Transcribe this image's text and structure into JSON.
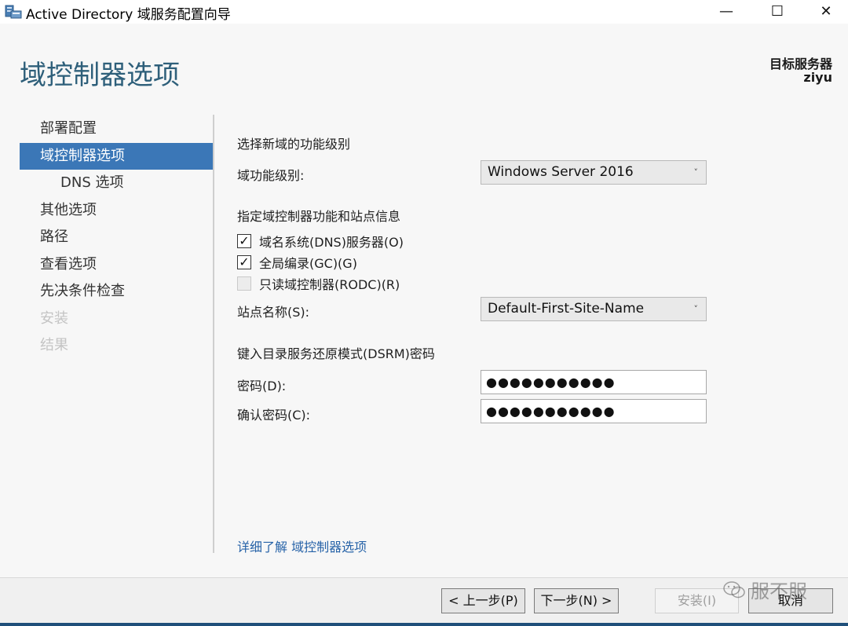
{
  "window": {
    "title": "Active Directory 域服务配置向导",
    "minimize_glyph": "—",
    "maximize_glyph": "☐",
    "close_glyph": "✕",
    "icon": "server-wizard-icon"
  },
  "header": {
    "page_title": "域控制器选项",
    "target_label": "目标服务器",
    "target_name": "ziyu"
  },
  "nav": {
    "items": [
      {
        "label": "部署配置",
        "state": "normal"
      },
      {
        "label": "域控制器选项",
        "state": "active"
      },
      {
        "label": "DNS 选项",
        "state": "sub"
      },
      {
        "label": "其他选项",
        "state": "normal"
      },
      {
        "label": "路径",
        "state": "normal"
      },
      {
        "label": "查看选项",
        "state": "normal"
      },
      {
        "label": "先决条件检查",
        "state": "normal"
      },
      {
        "label": "安装",
        "state": "disabled"
      },
      {
        "label": "结果",
        "state": "disabled"
      }
    ]
  },
  "form": {
    "functional_level_section": "选择新域的功能级别",
    "domain_level_label": "域功能级别:",
    "domain_level_value": "Windows Server 2016",
    "capabilities_section": "指定域控制器功能和站点信息",
    "dns_checkbox": {
      "label": "域名系统(DNS)服务器(O)",
      "checked": true,
      "mark": "✓"
    },
    "gc_checkbox": {
      "label": "全局编录(GC)(G)",
      "checked": true,
      "mark": "✓"
    },
    "rodc_checkbox": {
      "label": "只读域控制器(RODC)(R)",
      "checked": false,
      "mark": ""
    },
    "site_label": "站点名称(S):",
    "site_value": "Default-First-Site-Name",
    "dsrm_section": "键入目录服务还原模式(DSRM)密码",
    "password_label": "密码(D):",
    "password_value": "●●●●●●●●●●●",
    "confirm_label": "确认密码(C):",
    "confirm_value": "●●●●●●●●●●●",
    "dropdown_glyph": "˅"
  },
  "learn_more": "详细了解 域控制器选项",
  "buttons": {
    "prev": "< 上一步(P)",
    "next": "下一步(N) >",
    "install": "安装(I)",
    "cancel": "取消"
  },
  "watermark": {
    "icon": "wechat-icon",
    "text": "服不服"
  },
  "colors": {
    "heading": "#2e5f7a",
    "nav_active": "#3b77b7",
    "link": "#2763a8"
  }
}
